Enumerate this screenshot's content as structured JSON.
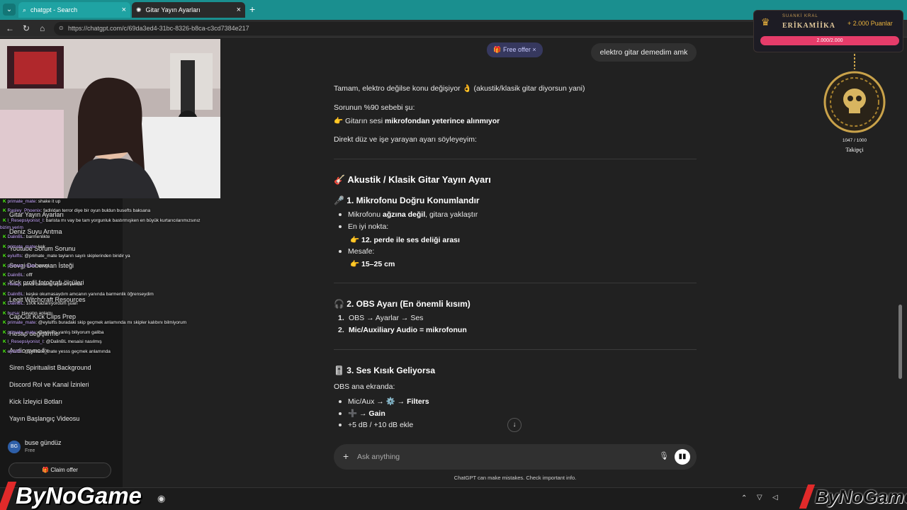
{
  "browser": {
    "tabs": [
      {
        "label": "chatgpt - Search",
        "icon": "search-icon"
      },
      {
        "label": "Gitar Yayın Ayarları",
        "icon": "chatgpt-icon"
      }
    ],
    "url": "https://chatgpt.com/c/69da3ed4-31bc-8326-b8ca-c3cd7384e217"
  },
  "sidebar": {
    "items": [
      "Gitar Yayın Ayarları",
      "Deniz Suyu Arıtma",
      "Youtube Sorum Sorunu",
      "Sevgi Doberman İsteği",
      "Kick profil fotoğrafı ölçüleri",
      "Legit Witchcraft Resources",
      "CapCut Kick Clips Prep",
      "Hesap değiştirme",
      "Audio sync fix",
      "Siren Spiritualist Background",
      "Discord Rol ve Kanal İzinleri",
      "Kick İzleyici Botları",
      "Yayın Başlangıç Videosu"
    ],
    "user": {
      "initials": "BG",
      "name": "buse gündüz",
      "plan": "Free"
    },
    "claim_label": "Claim offer"
  },
  "stream_chat": [
    {
      "user": "primate_mate",
      "text": "shake it up"
    },
    {
      "user": "Rasley_Phoenix",
      "text": "fadlıldan terror diye bir oyun buldun busefts baksana"
    },
    {
      "user": "l_Resepsiyonist_l",
      "text": "barista mı vay be tam yorgunluk bastırmışken en büyük kurtarıcılarımızsınız"
    },
    {
      "user": "bizim yerim",
      "text": ""
    },
    {
      "user": "DalinBL",
      "text": "barmenlikte"
    },
    {
      "user": "primate_mate",
      "text": "kek"
    },
    {
      "user": "eylulfts",
      "text": "@primate_mate tayların sayılı skiplerinden biridir ya"
    },
    {
      "user": "primate_mate",
      "text": "sevgi"
    },
    {
      "user": "DalinBL",
      "text": "offf"
    },
    {
      "user": "Hesap",
      "text": "kendi barlarını açarsın ileride"
    },
    {
      "user": "DalinBL",
      "text": "keşke okumasaydım amcanın yanında barmenlik öğrenseydim"
    },
    {
      "user": "DalinBL",
      "text": "100k kazanıyordum şuan"
    },
    {
      "user": "bursa",
      "text": "Hayatın anlamı"
    },
    {
      "user": "primate_mate",
      "text": "@eylulfts buradaki skip geçmek anlamında mı skipler kalıbını bilmiyorum"
    },
    {
      "user": "primate_mate",
      "text": "@eylulfts yanlış biliyorum galiba"
    },
    {
      "user": "l_Resepsiyonist_l",
      "text": "@DalinBL mesaisi nasılmış"
    },
    {
      "user": "eylulfts",
      "text": "@primate_mate yesss geçmek anlamında"
    }
  ],
  "conversation": {
    "free_offer": "Free offer",
    "user_message": "elektro gitar demedim amk",
    "intro": "Tamam, elektro değilse konu değişiyor 👌 (akustik/klasik gitar diyorsun yani)",
    "reason_line": "Sorunun %90 sebebi şu:",
    "reason_pre": "👉 Gitarın sesi ",
    "reason_bold": "mikrofondan yeterince alınmıyor",
    "direct": "Direkt düz ve işe yarayan ayarı söyleyeyim:",
    "section_title": "🎸 Akustik / Klasik Gitar Yayın Ayarı",
    "s1_title": "🎤 1. Mikrofonu Doğru Konumlandır",
    "s1_b1_pre": "Mikrofonu ",
    "s1_b1_bold": "ağzına değil",
    "s1_b1_post": ", gitara yaklaştır",
    "s1_b2": "En iyi nokta:",
    "s1_b2_sub_pre": "👉 ",
    "s1_b2_sub": "12. perde ile ses deliği arası",
    "s1_b3": "Mesafe:",
    "s1_b3_sub_pre": "👉 ",
    "s1_b3_sub": "15–25 cm",
    "s2_title": "🎧 2. OBS Ayarı (En önemli kısım)",
    "s2_i1_num": "1.",
    "s2_i1": "OBS → Ayarlar → Ses",
    "s2_i2_num": "2.",
    "s2_i2": "Mic/Auxiliary Audio = mikrofonun",
    "s3_title": "🎚️ 3. Ses Kısık Geliyorsa",
    "s3_intro": "OBS ana ekranda:",
    "s3_b1_pre": "Mic/Aux → ⚙️ → ",
    "s3_b1_bold": "Filters",
    "s3_b2_pre": "➕ → ",
    "s3_b2_bold": "Gain",
    "s3_b3": "+5 dB / +10 dB ekle"
  },
  "composer": {
    "placeholder": "Ask anything",
    "disclaimer": "ChatGPT can make mistakes. Check important info."
  },
  "overlay": {
    "alert_title": "SUANKİ KRAL",
    "alert_name": "ERİKAMİİKA",
    "alert_points": "+ 2.000 Puanlar",
    "progress_text": "2.000/2.000",
    "progress_fraction": 1.0,
    "follower_count": "1047 / 1000",
    "follower_label": "Takipçi",
    "logo": "ByNoGame",
    "accent": "#e53c6a"
  }
}
